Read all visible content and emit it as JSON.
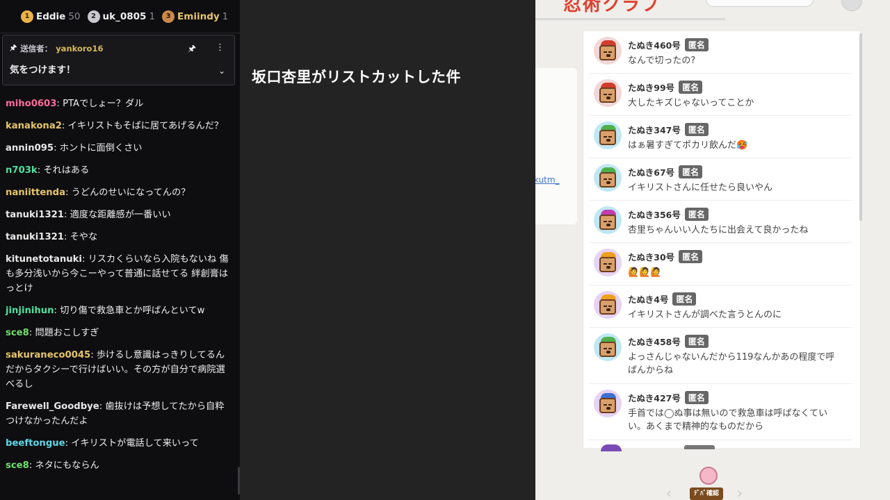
{
  "leaderboard": [
    {
      "rank": "1",
      "name": "Eddie",
      "score": "50",
      "color": "#e8b34a"
    },
    {
      "rank": "2",
      "name": "uk_0805",
      "score": "1",
      "color": "#c9c9cf"
    },
    {
      "rank": "3",
      "name": "Emiindy",
      "score": "1",
      "color": "#c98a4a"
    }
  ],
  "pinned": {
    "pin_icon": "pin-icon",
    "sender_label": "送信者：",
    "sender": "yankoro16",
    "message": "気をつけます！",
    "more_icon": "⋮",
    "chevron_icon": "⌄"
  },
  "chat": [
    {
      "user": "miho0603",
      "color": "#ff6b9a",
      "text": "PTAでしょー？ダル"
    },
    {
      "user": "kanakona2",
      "color": "#e7c66a",
      "text": "イキリストもそばに居てあげるんだ？"
    },
    {
      "user": "annin095",
      "color": "#e8e8e8",
      "text": "ホントに面倒くさい"
    },
    {
      "user": "n703k",
      "color": "#4ee0a0",
      "text": "それはある"
    },
    {
      "user": "naniittenda",
      "color": "#e7c66a",
      "text": "うどんのせいになってんの？"
    },
    {
      "user": "tanuki1321",
      "color": "#e8e8e8",
      "text": "適度な距離感が一番いい"
    },
    {
      "user": "tanuki1321",
      "color": "#e8e8e8",
      "text": "そやな"
    },
    {
      "user": "kitunetotanuki",
      "color": "#e8e8e8",
      "text": "リスカくらいなら入院もないね 傷も多分浅いから今こーやって普通に話せてる 絆創膏はっとけ"
    },
    {
      "user": "jinjinihun",
      "color": "#4ee0a0",
      "text": "切り傷で救急車とか呼ばんといてw"
    },
    {
      "user": "sce8",
      "color": "#6fe06a",
      "text": "問題おこしすぎ"
    },
    {
      "user": "sakuraneco0045",
      "color": "#e7c66a",
      "text": "歩けるし意識はっきりしてるんだからタクシーで行けばいい。その方が自分で病院選べるし"
    },
    {
      "user": "Farewell_Goodbye",
      "color": "#e8e8e8",
      "text": "歯抜けは予想してたから自粋つけなかったんだよ"
    },
    {
      "user": "beeftongue",
      "color": "#5fd8e8",
      "text": "イキリストが電話して来いって"
    },
    {
      "user": "sce8",
      "color": "#6fe06a",
      "text": "ネタにもならん"
    }
  ],
  "middle": {
    "title": "坂口杏里がリストカットした件"
  },
  "web": {
    "logo_text": "忍術クラブ",
    "link_text": "kutm_",
    "badge_label": "匿名",
    "mascot_label": "ﾃﾞﾊﾞ確認",
    "prev_arrow": "‹",
    "next_arrow": "›",
    "comments": [
      {
        "name": "たぬき460号",
        "text": "なんで切ったの?",
        "hat": "#d23c2c",
        "ring": "#f1d7d7"
      },
      {
        "name": "たぬき99号",
        "text": "大したキズじゃないってことか",
        "hat": "#d23c2c",
        "ring": "#f1d7d7"
      },
      {
        "name": "たぬき347号",
        "text": "はぁ暑すぎてポカリ飲んだ🥵",
        "hat": "#4fb04a",
        "ring": "#bfe7f3"
      },
      {
        "name": "たぬき67号",
        "text": "イキリストさんに任せたら良いやん",
        "hat": "#4fb04a",
        "ring": "#bfe7f3"
      },
      {
        "name": "たぬき356号",
        "text": "杏里ちゃんいい人たちに出会えて良かったね",
        "hat": "#c23cb0",
        "ring": "#bfe7f3"
      },
      {
        "name": "たぬき30号",
        "text": "🙋🙋🙋",
        "hat": "#f0a020",
        "ring": "#e6d2f2"
      },
      {
        "name": "たぬき4号",
        "text": "イキリストさんが調べた言うとんのに",
        "hat": "#f0a020",
        "ring": "#e6d2f2"
      },
      {
        "name": "たぬき458号",
        "text": "よっさんじゃないんだから119なんかあの程度で呼ばんからね",
        "hat": "#4fb04a",
        "ring": "#bfe7f3"
      },
      {
        "name": "たぬき427号",
        "text": "手首では◯ぬ事は無いので救急車は呼ばなくていい。あくまで精神的なものだから",
        "hat": "#3c6fd2",
        "ring": "#e6d2f2"
      }
    ]
  }
}
